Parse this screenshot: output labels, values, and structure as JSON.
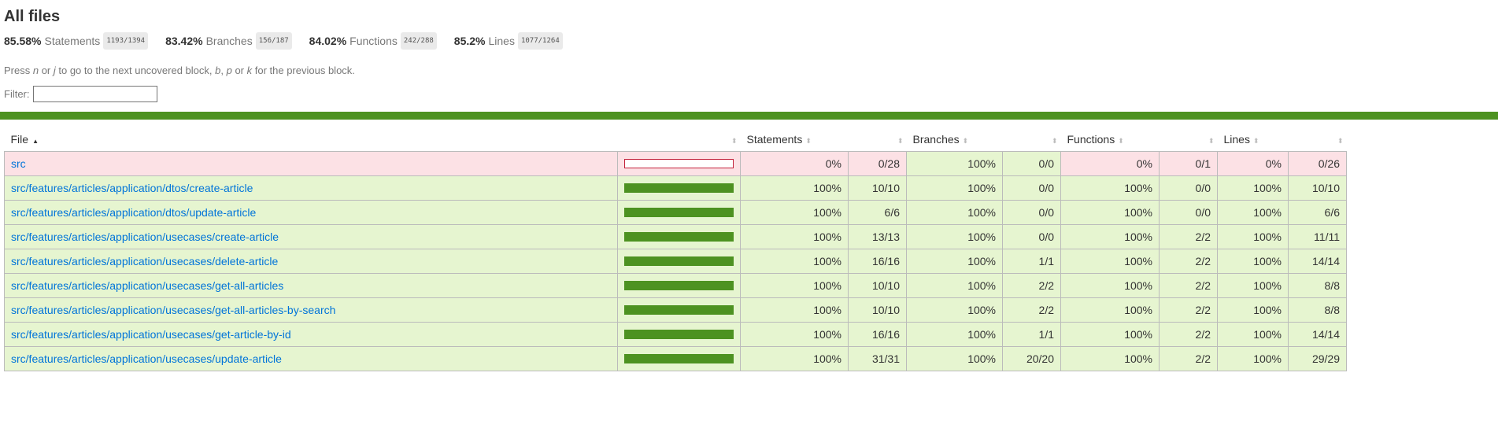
{
  "page_title": "All files",
  "summary": [
    {
      "pct": "85.58%",
      "label": "Statements",
      "fraction": "1193/1394"
    },
    {
      "pct": "83.42%",
      "label": "Branches",
      "fraction": "156/187"
    },
    {
      "pct": "84.02%",
      "label": "Functions",
      "fraction": "242/288"
    },
    {
      "pct": "85.2%",
      "label": "Lines",
      "fraction": "1077/1264"
    }
  ],
  "help": {
    "press": "Press ",
    "n": "n",
    "or1": " or ",
    "j": "j",
    "mid": " to go to the next uncovered block, ",
    "b": "b",
    "comma": ", ",
    "p": "p",
    "or2": " or ",
    "k": "k",
    "end": " for the previous block."
  },
  "filter": {
    "label": "Filter:",
    "value": ""
  },
  "colors": {
    "high_bg": "#e6f5d0",
    "low_bg": "#fce1e5",
    "status_line": "#4d9221",
    "link": "#0074D9"
  },
  "table": {
    "headers": {
      "file": "File",
      "statements": "Statements",
      "branches": "Branches",
      "functions": "Functions",
      "lines": "Lines"
    },
    "rows": [
      {
        "file": "src",
        "coverage": 0,
        "level": "low",
        "stmt_pct": "0%",
        "stmt_frac": "0/28",
        "stmt_level": "low",
        "br_pct": "100%",
        "br_frac": "0/0",
        "br_level": "high",
        "fn_pct": "0%",
        "fn_frac": "0/1",
        "fn_level": "low",
        "ln_pct": "0%",
        "ln_frac": "0/26",
        "ln_level": "low"
      },
      {
        "file": "src/features/articles/application/dtos/create-article",
        "coverage": 100,
        "level": "high",
        "stmt_pct": "100%",
        "stmt_frac": "10/10",
        "stmt_level": "high",
        "br_pct": "100%",
        "br_frac": "0/0",
        "br_level": "high",
        "fn_pct": "100%",
        "fn_frac": "0/0",
        "fn_level": "high",
        "ln_pct": "100%",
        "ln_frac": "10/10",
        "ln_level": "high"
      },
      {
        "file": "src/features/articles/application/dtos/update-article",
        "coverage": 100,
        "level": "high",
        "stmt_pct": "100%",
        "stmt_frac": "6/6",
        "stmt_level": "high",
        "br_pct": "100%",
        "br_frac": "0/0",
        "br_level": "high",
        "fn_pct": "100%",
        "fn_frac": "0/0",
        "fn_level": "high",
        "ln_pct": "100%",
        "ln_frac": "6/6",
        "ln_level": "high"
      },
      {
        "file": "src/features/articles/application/usecases/create-article",
        "coverage": 100,
        "level": "high",
        "stmt_pct": "100%",
        "stmt_frac": "13/13",
        "stmt_level": "high",
        "br_pct": "100%",
        "br_frac": "0/0",
        "br_level": "high",
        "fn_pct": "100%",
        "fn_frac": "2/2",
        "fn_level": "high",
        "ln_pct": "100%",
        "ln_frac": "11/11",
        "ln_level": "high"
      },
      {
        "file": "src/features/articles/application/usecases/delete-article",
        "coverage": 100,
        "level": "high",
        "stmt_pct": "100%",
        "stmt_frac": "16/16",
        "stmt_level": "high",
        "br_pct": "100%",
        "br_frac": "1/1",
        "br_level": "high",
        "fn_pct": "100%",
        "fn_frac": "2/2",
        "fn_level": "high",
        "ln_pct": "100%",
        "ln_frac": "14/14",
        "ln_level": "high"
      },
      {
        "file": "src/features/articles/application/usecases/get-all-articles",
        "coverage": 100,
        "level": "high",
        "stmt_pct": "100%",
        "stmt_frac": "10/10",
        "stmt_level": "high",
        "br_pct": "100%",
        "br_frac": "2/2",
        "br_level": "high",
        "fn_pct": "100%",
        "fn_frac": "2/2",
        "fn_level": "high",
        "ln_pct": "100%",
        "ln_frac": "8/8",
        "ln_level": "high"
      },
      {
        "file": "src/features/articles/application/usecases/get-all-articles-by-search",
        "coverage": 100,
        "level": "high",
        "stmt_pct": "100%",
        "stmt_frac": "10/10",
        "stmt_level": "high",
        "br_pct": "100%",
        "br_frac": "2/2",
        "br_level": "high",
        "fn_pct": "100%",
        "fn_frac": "2/2",
        "fn_level": "high",
        "ln_pct": "100%",
        "ln_frac": "8/8",
        "ln_level": "high"
      },
      {
        "file": "src/features/articles/application/usecases/get-article-by-id",
        "coverage": 100,
        "level": "high",
        "stmt_pct": "100%",
        "stmt_frac": "16/16",
        "stmt_level": "high",
        "br_pct": "100%",
        "br_frac": "1/1",
        "br_level": "high",
        "fn_pct": "100%",
        "fn_frac": "2/2",
        "fn_level": "high",
        "ln_pct": "100%",
        "ln_frac": "14/14",
        "ln_level": "high"
      },
      {
        "file": "src/features/articles/application/usecases/update-article",
        "coverage": 100,
        "level": "high",
        "stmt_pct": "100%",
        "stmt_frac": "31/31",
        "stmt_level": "high",
        "br_pct": "100%",
        "br_frac": "20/20",
        "br_level": "high",
        "fn_pct": "100%",
        "fn_frac": "2/2",
        "fn_level": "high",
        "ln_pct": "100%",
        "ln_frac": "29/29",
        "ln_level": "high"
      }
    ]
  }
}
